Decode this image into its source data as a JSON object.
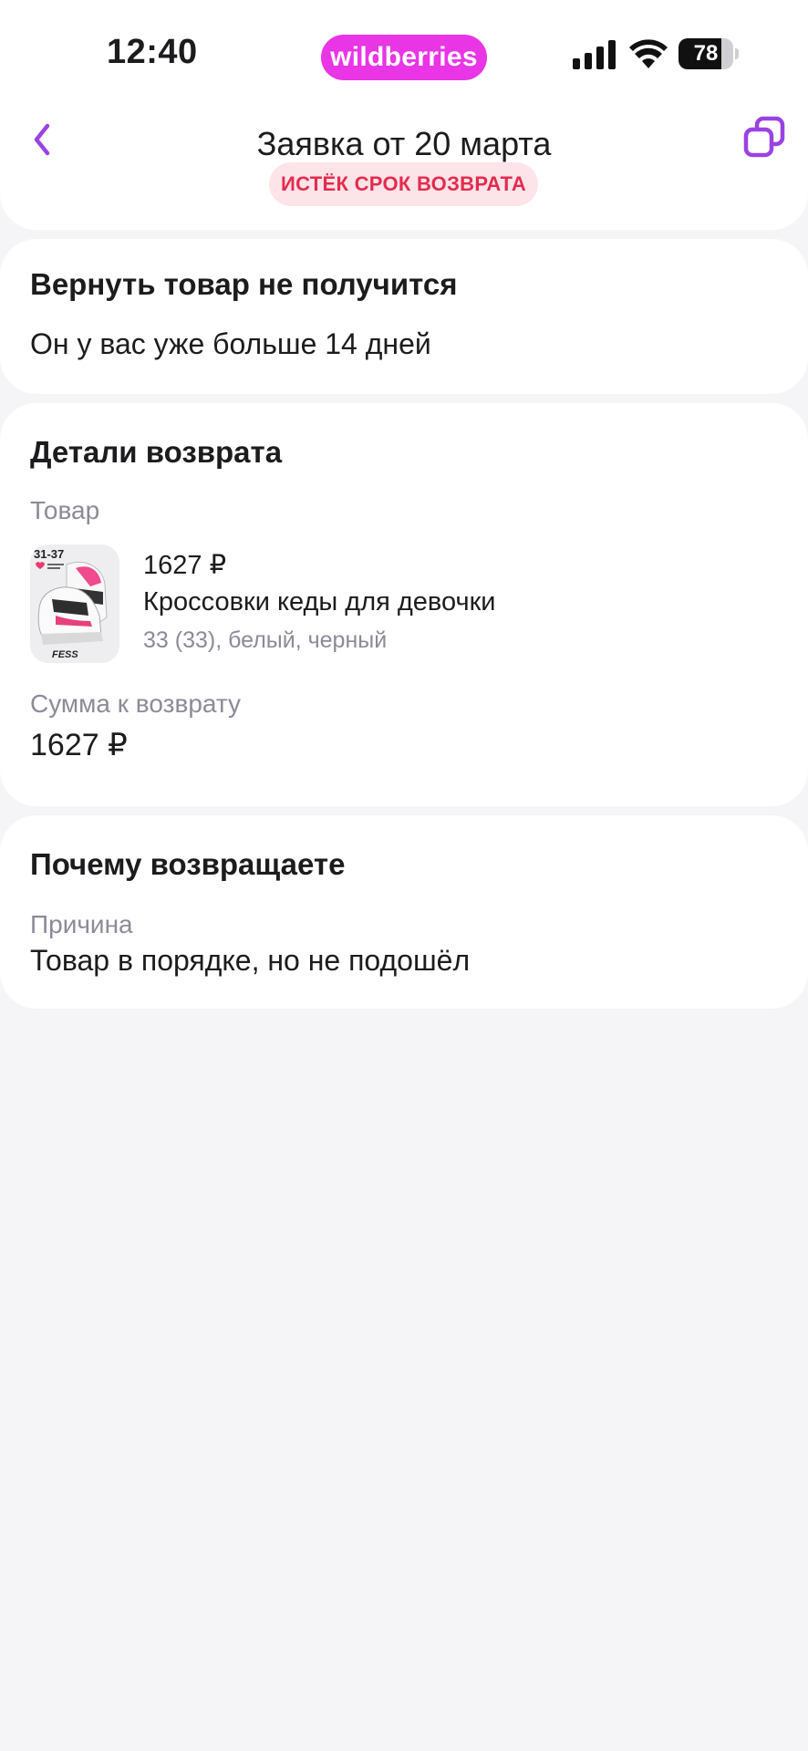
{
  "status_bar": {
    "time": "12:40",
    "brand": "wildberries",
    "battery_level": 78,
    "battery_text": "78"
  },
  "header": {
    "title": "Заявка от 20 марта",
    "badge": "ИСТЁК СРОК ВОЗВРАТА"
  },
  "notice": {
    "title": "Вернуть товар не получится",
    "text": "Он у вас уже больше 14 дней"
  },
  "details": {
    "title": "Детали возврата",
    "product_label": "Товар",
    "product": {
      "price": "1627 ₽",
      "name": "Кроссовки кеды для девочки",
      "variant": "33 (33), белый, черный",
      "image_text_size": "31-37",
      "image_text_brand": "FESS"
    },
    "refund_label": "Сумма к возврату",
    "refund_amount": "1627 ₽"
  },
  "reason": {
    "title": "Почему возвращаете",
    "label": "Причина",
    "value": "Товар в порядке, но не подошёл"
  },
  "colors": {
    "accent": "#9b42e3",
    "brand": "#e935e6",
    "badge_text": "#e32c4f",
    "badge_bg": "#fde4e8",
    "background": "#f5f5f8",
    "secondary_text": "#8b8b99"
  }
}
